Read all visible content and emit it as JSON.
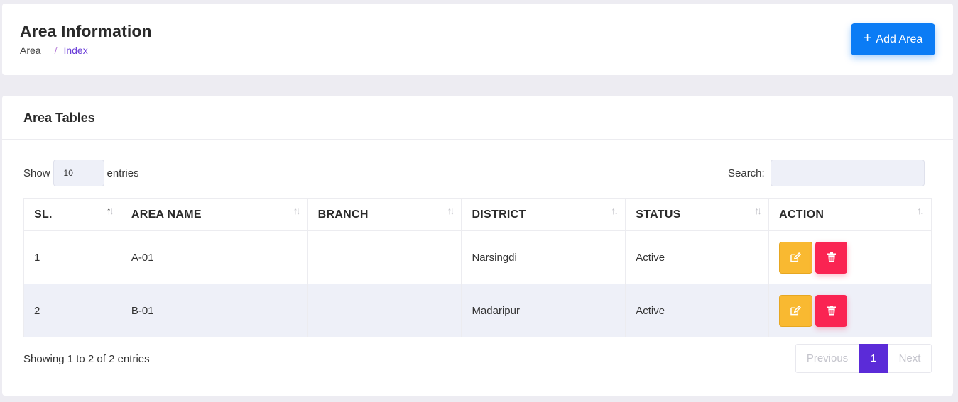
{
  "header": {
    "title": "Area Information",
    "breadcrumb": [
      "Area",
      "Index"
    ],
    "breadcrumb_sep": "/",
    "add_button_label": "Add Area",
    "add_button_icon": "+"
  },
  "card": {
    "title": "Area Tables",
    "show_label": "Show",
    "entries_label": "entries",
    "page_length": "10",
    "search_label": "Search:",
    "search_value": ""
  },
  "table": {
    "columns": [
      "SL.",
      "AREA NAME",
      "BRANCH",
      "DISTRICT",
      "STATUS",
      "ACTION"
    ],
    "rows": [
      {
        "sl": "1",
        "area_name": "A-01",
        "branch": "",
        "district": "Narsingdi",
        "status": "Active"
      },
      {
        "sl": "2",
        "area_name": "B-01",
        "branch": "",
        "district": "Madaripur",
        "status": "Active"
      }
    ]
  },
  "footer": {
    "info": "Showing 1 to 2 of 2 entries",
    "previous_label": "Previous",
    "current_page": "1",
    "next_label": "Next"
  },
  "colors": {
    "primary": "#0b7cf5",
    "accent": "#5b2bd8",
    "edit": "#f9b931",
    "delete": "#fa2452"
  }
}
